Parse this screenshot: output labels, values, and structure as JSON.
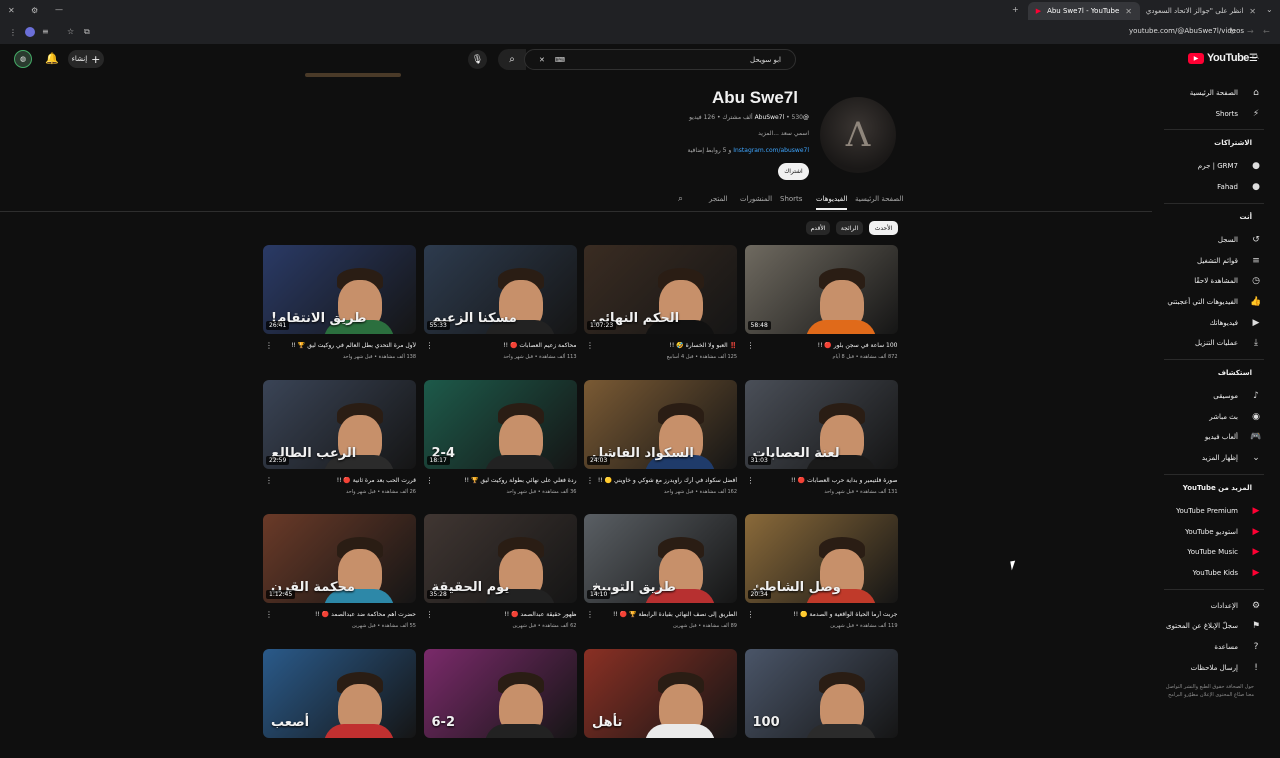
{
  "browser": {
    "tabs": [
      {
        "title": "Abu Swe7l - YouTube",
        "active": true
      },
      {
        "title": "انظر على \"جوالز الاتحاد السعودي\"",
        "active": false
      }
    ],
    "url": "youtube.com/@AbuSwe7l/videos"
  },
  "header": {
    "search_value": "ابو سويحل",
    "create_label": "إنشاء",
    "logo_text": "YouTube",
    "logo_country": "SA"
  },
  "channel": {
    "name": "Abu Swe7l",
    "handle": "@AbuSwe7l",
    "stats": "530 ألف مشترك • 126 فيديو",
    "description": "اسمي سعد ...المزيد",
    "link_text": "Instagram.com/abuswe7l",
    "link_suffix": "و 5 روابط إضافية",
    "subscribe_label": "اشتراك"
  },
  "channel_tabs": [
    {
      "label": "الصفحة الرئيسية",
      "active": false
    },
    {
      "label": "الفيديوهات",
      "active": true
    },
    {
      "label": "Shorts",
      "active": false
    },
    {
      "label": "المنشورات",
      "active": false
    },
    {
      "label": "المتجر",
      "active": false
    }
  ],
  "chips": [
    {
      "label": "الأحدث",
      "active": true
    },
    {
      "label": "الرائجة",
      "active": false
    },
    {
      "label": "الأقدم",
      "active": false
    }
  ],
  "videos": [
    {
      "title": "100 ساعة في سجن بلور 🔴 !!",
      "meta": "872 ألف مشاهدة • قبل 8 أيام",
      "duration": "58:48",
      "thumb_text": "",
      "bg": "#6f6a60",
      "shirt": "#e06a1a"
    },
    {
      "title": "‼️ العبو ولا الخسارة 🤣 !!",
      "meta": "125 ألف مشاهدة • قبل 4 أسابيع",
      "duration": "1:07:23",
      "thumb_text": "الحكم النهائي",
      "bg": "#3a2c22",
      "shirt": "#111111"
    },
    {
      "title": "محاكمة زعيم العصابات 🔴 !!",
      "meta": "113 ألف مشاهدة • قبل شهر واحد",
      "duration": "55:33",
      "thumb_text": "مسكنا الزعيم",
      "bg": "#2d3b4e",
      "shirt": "#222222"
    },
    {
      "title": "لأول مرة التحدي بطل العالم في روكيت ليق 🏆 !!",
      "meta": "138 ألف مشاهدة • قبل شهر واحد",
      "duration": "26:41",
      "thumb_text": "طريق الانتقام!",
      "bg": "#2a3a66",
      "shirt": "#2b6f3e"
    },
    {
      "title": "صورة فلتيمير و بداية حرب العصابات 🔴 !!",
      "meta": "131 ألف مشاهدة • قبل شهر واحد",
      "duration": "31:03",
      "thumb_text": "لعنة العصابات",
      "bg": "#4a4f58",
      "shirt": "#1a1a1a"
    },
    {
      "title": "أفضل سكواد في أرك راويدرز مع شوكي و خاويني 🟡 !!",
      "meta": "162 ألف مشاهدة • قبل شهر واحد",
      "duration": "24:03",
      "thumb_text": "السكواد الفاشل",
      "bg": "#7a5a34",
      "shirt": "#1f3b6a"
    },
    {
      "title": "ردة فعلي على نهائي بطولة روكيت ليق 🏆 !!",
      "meta": "36 ألف مشاهدة • قبل شهر واحد",
      "duration": "18:17",
      "thumb_text": "2-4",
      "bg": "#1d5a4a",
      "shirt": "#222222"
    },
    {
      "title": "قررت الحب بعد مرة ثانية 🔴 !!",
      "meta": "26 ألف مشاهدة • قبل شهر واحد",
      "duration": "22:59",
      "thumb_text": "الرعب الطالع",
      "bg": "#3a4456",
      "shirt": "#2b2b2b"
    },
    {
      "title": "جربت أرما الحياة الواقعية و الصدمة 🟡 !!",
      "meta": "119 ألف مشاهدة • قبل شهرين",
      "duration": "20:34",
      "thumb_text": "وصل الشاطئ",
      "bg": "#8a6a3a",
      "shirt": "#c03a2a"
    },
    {
      "title": "الطريق إلى نصف النهائي بقيادة الرابطة 🏆 🔴 !!",
      "meta": "89 ألف مشاهدة • قبل شهرين",
      "duration": "14:10",
      "thumb_text": "طريق التوبيخ",
      "bg": "#5a5f64",
      "shirt": "#b73030"
    },
    {
      "title": "ظهور حقيقة عبدالصمد 🔴 !!",
      "meta": "62 ألف مشاهدة • قبل شهرين",
      "duration": "35:28",
      "thumb_text": "يوم الحقيقة",
      "bg": "#403632",
      "shirt": "#222222"
    },
    {
      "title": "حضرت أهم محاكمة ضد عبدالصمد 🔴 !!",
      "meta": "55 ألف مشاهدة • قبل شهرين",
      "duration": "1:12:45",
      "thumb_text": "محكمة القرن",
      "bg": "#6a3a28",
      "shirt": "#2d88a8"
    },
    {
      "title": "",
      "meta": "",
      "duration": "",
      "thumb_text": "100",
      "bg": "#4a5568",
      "shirt": "#2b2b2b"
    },
    {
      "title": "",
      "meta": "",
      "duration": "",
      "thumb_text": "تأهل",
      "bg": "#8a3024",
      "shirt": "#eaeaea"
    },
    {
      "title": "",
      "meta": "",
      "duration": "",
      "thumb_text": "6-2",
      "bg": "#7a2a6a",
      "shirt": "#222222"
    },
    {
      "title": "",
      "meta": "",
      "duration": "",
      "thumb_text": "أصعب",
      "bg": "#2a5a8a",
      "shirt": "#c03030"
    }
  ],
  "sidebar": {
    "main": [
      {
        "label": "الصفحة الرئيسية",
        "icon": "⌂",
        "name": "home"
      },
      {
        "label": "Shorts",
        "icon": "⚡",
        "name": "shorts"
      }
    ],
    "subs_head": "الاشتراكات",
    "subs": [
      {
        "label": "GRM7 | جرم",
        "icon": "●",
        "name": "sub-grm7"
      },
      {
        "label": "Fahad",
        "icon": "●",
        "name": "sub-fahad"
      }
    ],
    "you_head": "أنت",
    "you": [
      {
        "label": "السجل",
        "icon": "↺",
        "name": "history"
      },
      {
        "label": "قوائم التشغيل",
        "icon": "≡",
        "name": "playlists"
      },
      {
        "label": "المشاهدة لاحقًا",
        "icon": "◷",
        "name": "watch-later"
      },
      {
        "label": "الفيديوهات التي أعجبتني",
        "icon": "👍",
        "name": "liked"
      },
      {
        "label": "فيديوهاتك",
        "icon": "▶",
        "name": "your-videos"
      },
      {
        "label": "عمليات التنزيل",
        "icon": "⤓",
        "name": "downloads"
      }
    ],
    "explore_head": "استكشاف",
    "explore": [
      {
        "label": "موسيقى",
        "icon": "♪",
        "name": "music"
      },
      {
        "label": "بث مباشر",
        "icon": "◉",
        "name": "live"
      },
      {
        "label": "ألعاب فيديو",
        "icon": "🎮",
        "name": "gaming"
      },
      {
        "label": "إظهار المزيد",
        "icon": "⌄",
        "name": "show-more"
      }
    ],
    "more_head": "المزيد من YouTube",
    "more": [
      {
        "label": "YouTube Premium",
        "icon": "▶",
        "name": "premium"
      },
      {
        "label": "استوديو YouTube",
        "icon": "▶",
        "name": "studio"
      },
      {
        "label": "YouTube Music",
        "icon": "▶",
        "name": "yt-music"
      },
      {
        "label": "YouTube Kids",
        "icon": "▶",
        "name": "yt-kids"
      }
    ],
    "settings": [
      {
        "label": "الإعدادات",
        "icon": "⚙",
        "name": "settings"
      },
      {
        "label": "سجلّ الإبلاغ عن المحتوى",
        "icon": "⚑",
        "name": "report-history"
      },
      {
        "label": "مساعدة",
        "icon": "?",
        "name": "help"
      },
      {
        "label": "إرسال ملاحظات",
        "icon": "!",
        "name": "feedback"
      }
    ],
    "footer": "حول الصحافة حقوق الطبع والنشر التواصل معنا صنّاع المحتوى الإعلان مطوّرو البرامج"
  },
  "colors": {
    "accent": "#ff0033",
    "link": "#3ea6ff",
    "bg": "#0f0f0f"
  }
}
